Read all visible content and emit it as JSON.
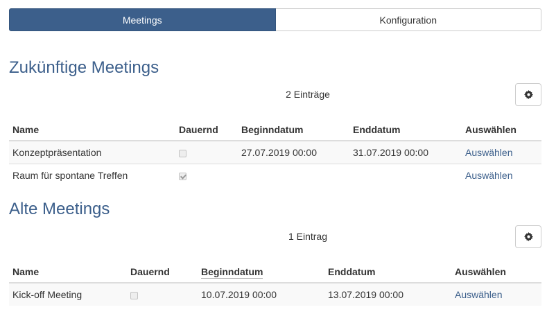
{
  "tabs": [
    {
      "label": "Meetings",
      "active": true
    },
    {
      "label": "Konfiguration",
      "active": false
    }
  ],
  "colors": {
    "accent": "#3c5f8b",
    "link": "#3c5f8b",
    "row_alt": "#f9f9f9"
  },
  "upcoming": {
    "title": "Zukünftige Meetings",
    "count_text": "2 Einträge",
    "settings_icon": "gear-icon",
    "columns": [
      "Name",
      "Dauernd",
      "Beginndatum",
      "Enddatum",
      "Auswählen"
    ],
    "rows": [
      {
        "name": "Konzeptpräsentation",
        "permanent": false,
        "start": "27.07.2019 00:00",
        "end": "31.07.2019 00:00",
        "action": "Auswählen"
      },
      {
        "name": "Raum für spontane Treffen",
        "permanent": true,
        "start": "",
        "end": "",
        "action": "Auswählen"
      }
    ]
  },
  "past": {
    "title": "Alte Meetings",
    "count_text": "1 Eintrag",
    "settings_icon": "gear-icon",
    "columns": [
      "Name",
      "Dauernd",
      "Beginndatum",
      "Enddatum",
      "Auswählen"
    ],
    "rows": [
      {
        "name": "Kick-off Meeting",
        "permanent": false,
        "start": "10.07.2019 00:00",
        "end": "13.07.2019 00:00",
        "action": "Auswählen"
      }
    ]
  }
}
